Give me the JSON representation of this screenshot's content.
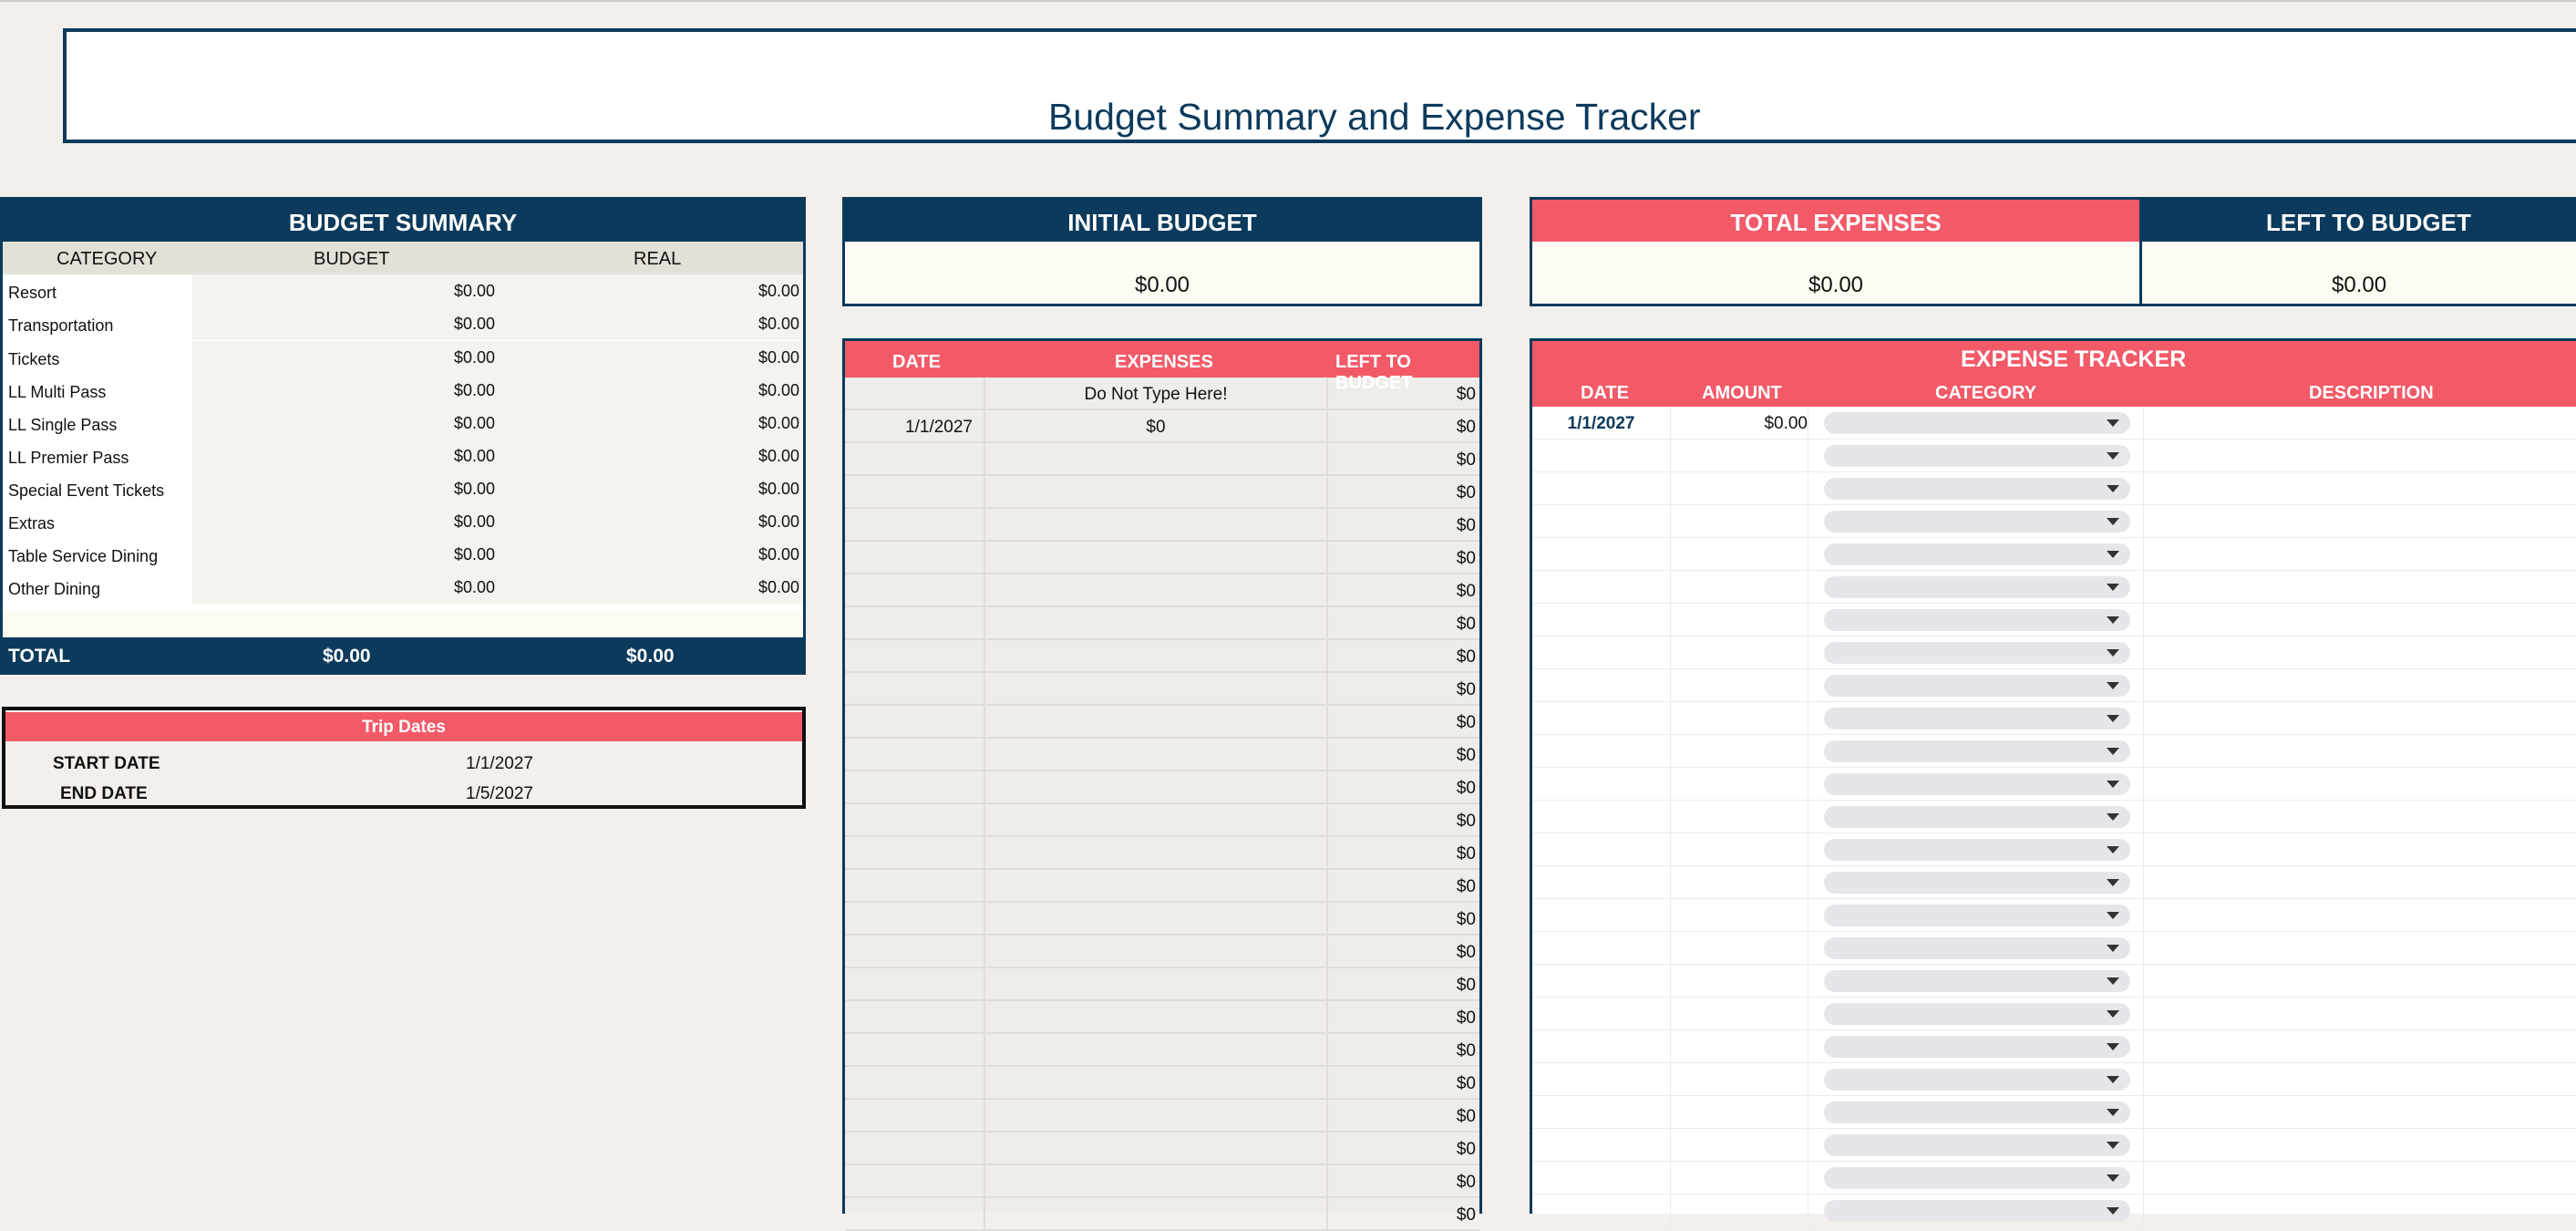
{
  "title": "Budget Summary and Expense Tracker",
  "colors": {
    "navy": "#0b3a5c",
    "coral": "#f25a68",
    "background": "#f2efec"
  },
  "budget_summary": {
    "header": "BUDGET SUMMARY",
    "columns": {
      "category": "CATEGORY",
      "budget": "BUDGET",
      "real": "REAL"
    },
    "rows": [
      {
        "category": "Resort",
        "budget": "$0.00",
        "real": "$0.00"
      },
      {
        "category": "Transportation",
        "budget": "$0.00",
        "real": "$0.00"
      },
      {
        "category": "Tickets",
        "budget": "$0.00",
        "real": "$0.00"
      },
      {
        "category": "LL Multi Pass",
        "budget": "$0.00",
        "real": "$0.00"
      },
      {
        "category": "LL Single Pass",
        "budget": "$0.00",
        "real": "$0.00"
      },
      {
        "category": "LL Premier Pass",
        "budget": "$0.00",
        "real": "$0.00"
      },
      {
        "category": "Special Event Tickets",
        "budget": "$0.00",
        "real": "$0.00"
      },
      {
        "category": "Extras",
        "budget": "$0.00",
        "real": "$0.00"
      },
      {
        "category": "Table Service Dining",
        "budget": "$0.00",
        "real": "$0.00"
      },
      {
        "category": "Other Dining",
        "budget": "$0.00",
        "real": "$0.00"
      }
    ],
    "total": {
      "label": "TOTAL",
      "budget": "$0.00",
      "real": "$0.00"
    }
  },
  "trip_dates": {
    "header": "Trip Dates",
    "start_label": "START DATE",
    "start_value": "1/1/2027",
    "end_label": "END DATE",
    "end_value": "1/5/2027"
  },
  "initial_budget": {
    "header": "INITIAL BUDGET",
    "value": "$0.00"
  },
  "total_expenses": {
    "header": "TOTAL EXPENSES",
    "value": "$0.00"
  },
  "left_to_budget": {
    "header": "LEFT TO BUDGET",
    "value": "$0.00"
  },
  "ledger": {
    "columns": {
      "date": "DATE",
      "expenses": "EXPENSES",
      "left": "LEFT TO BUDGET"
    },
    "rows": [
      {
        "date": "",
        "expenses": "Do Not Type Here!",
        "left": "$0"
      },
      {
        "date": "1/1/2027",
        "expenses": "$0",
        "left": "$0"
      },
      {
        "date": "",
        "expenses": "",
        "left": "$0"
      },
      {
        "date": "",
        "expenses": "",
        "left": "$0"
      },
      {
        "date": "",
        "expenses": "",
        "left": "$0"
      },
      {
        "date": "",
        "expenses": "",
        "left": "$0"
      },
      {
        "date": "",
        "expenses": "",
        "left": "$0"
      },
      {
        "date": "",
        "expenses": "",
        "left": "$0"
      },
      {
        "date": "",
        "expenses": "",
        "left": "$0"
      },
      {
        "date": "",
        "expenses": "",
        "left": "$0"
      },
      {
        "date": "",
        "expenses": "",
        "left": "$0"
      },
      {
        "date": "",
        "expenses": "",
        "left": "$0"
      },
      {
        "date": "",
        "expenses": "",
        "left": "$0"
      },
      {
        "date": "",
        "expenses": "",
        "left": "$0"
      },
      {
        "date": "",
        "expenses": "",
        "left": "$0"
      },
      {
        "date": "",
        "expenses": "",
        "left": "$0"
      },
      {
        "date": "",
        "expenses": "",
        "left": "$0"
      },
      {
        "date": "",
        "expenses": "",
        "left": "$0"
      },
      {
        "date": "",
        "expenses": "",
        "left": "$0"
      },
      {
        "date": "",
        "expenses": "",
        "left": "$0"
      },
      {
        "date": "",
        "expenses": "",
        "left": "$0"
      },
      {
        "date": "",
        "expenses": "",
        "left": "$0"
      },
      {
        "date": "",
        "expenses": "",
        "left": "$0"
      },
      {
        "date": "",
        "expenses": "",
        "left": "$0"
      },
      {
        "date": "",
        "expenses": "",
        "left": "$0"
      },
      {
        "date": "",
        "expenses": "",
        "left": "$0"
      }
    ]
  },
  "expense_tracker": {
    "title": "EXPENSE TRACKER",
    "columns": {
      "date": "DATE",
      "amount": "AMOUNT",
      "category": "CATEGORY",
      "description": "DESCRIPTION"
    },
    "rows": [
      {
        "date": "1/1/2027",
        "amount": "$0.00",
        "category": "",
        "description": ""
      },
      {
        "date": "",
        "amount": "",
        "category": "",
        "description": ""
      },
      {
        "date": "",
        "amount": "",
        "category": "",
        "description": ""
      },
      {
        "date": "",
        "amount": "",
        "category": "",
        "description": ""
      },
      {
        "date": "",
        "amount": "",
        "category": "",
        "description": ""
      },
      {
        "date": "",
        "amount": "",
        "category": "",
        "description": ""
      },
      {
        "date": "",
        "amount": "",
        "category": "",
        "description": ""
      },
      {
        "date": "",
        "amount": "",
        "category": "",
        "description": ""
      },
      {
        "date": "",
        "amount": "",
        "category": "",
        "description": ""
      },
      {
        "date": "",
        "amount": "",
        "category": "",
        "description": ""
      },
      {
        "date": "",
        "amount": "",
        "category": "",
        "description": ""
      },
      {
        "date": "",
        "amount": "",
        "category": "",
        "description": ""
      },
      {
        "date": "",
        "amount": "",
        "category": "",
        "description": ""
      },
      {
        "date": "",
        "amount": "",
        "category": "",
        "description": ""
      },
      {
        "date": "",
        "amount": "",
        "category": "",
        "description": ""
      },
      {
        "date": "",
        "amount": "",
        "category": "",
        "description": ""
      },
      {
        "date": "",
        "amount": "",
        "category": "",
        "description": ""
      },
      {
        "date": "",
        "amount": "",
        "category": "",
        "description": ""
      },
      {
        "date": "",
        "amount": "",
        "category": "",
        "description": ""
      },
      {
        "date": "",
        "amount": "",
        "category": "",
        "description": ""
      },
      {
        "date": "",
        "amount": "",
        "category": "",
        "description": ""
      },
      {
        "date": "",
        "amount": "",
        "category": "",
        "description": ""
      },
      {
        "date": "",
        "amount": "",
        "category": "",
        "description": ""
      },
      {
        "date": "",
        "amount": "",
        "category": "",
        "description": ""
      },
      {
        "date": "",
        "amount": "",
        "category": "",
        "description": ""
      }
    ]
  }
}
